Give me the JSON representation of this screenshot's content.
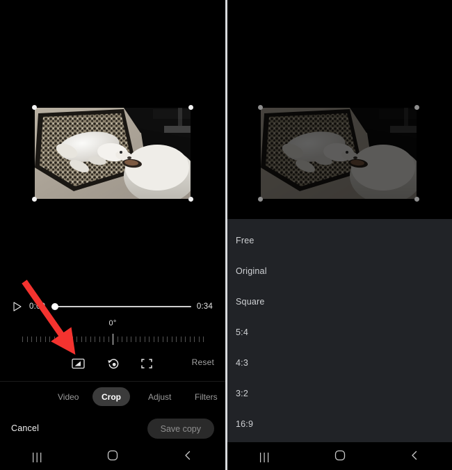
{
  "app": {
    "accent_red": "#f4332f",
    "list_bg": "#212327",
    "active_pill_bg": "#3b3b3b"
  },
  "player": {
    "play_icon": "play-triangle-icon",
    "current_time": "0:00",
    "total_time": "0:34",
    "progress_percent": 0
  },
  "rotation": {
    "angle_label": "0°",
    "value": 0,
    "tick_count": 41
  },
  "crop_tools": {
    "aspect_ratio_icon": "aspect-ratio-icon",
    "rotate_icon": "rotate-icon",
    "free_crop_icon": "free-crop-brackets-icon",
    "reset_label": "Reset"
  },
  "tabs": [
    {
      "label": "Video",
      "active": false
    },
    {
      "label": "Crop",
      "active": true
    },
    {
      "label": "Adjust",
      "active": false
    },
    {
      "label": "Filters",
      "active": false
    }
  ],
  "actions": {
    "cancel_label": "Cancel",
    "save_label": "Save copy"
  },
  "aspect_ratios": [
    {
      "label": "Free"
    },
    {
      "label": "Original"
    },
    {
      "label": "Square"
    },
    {
      "label": "5:4"
    },
    {
      "label": "4:3"
    },
    {
      "label": "3:2"
    },
    {
      "label": "16:9"
    }
  ],
  "navbar": {
    "recents": "|||",
    "home_icon": "home-square-icon",
    "back_icon": "back-chevron-icon"
  },
  "annotation": {
    "type": "red-arrow",
    "points_to": "aspect-ratio-icon"
  }
}
